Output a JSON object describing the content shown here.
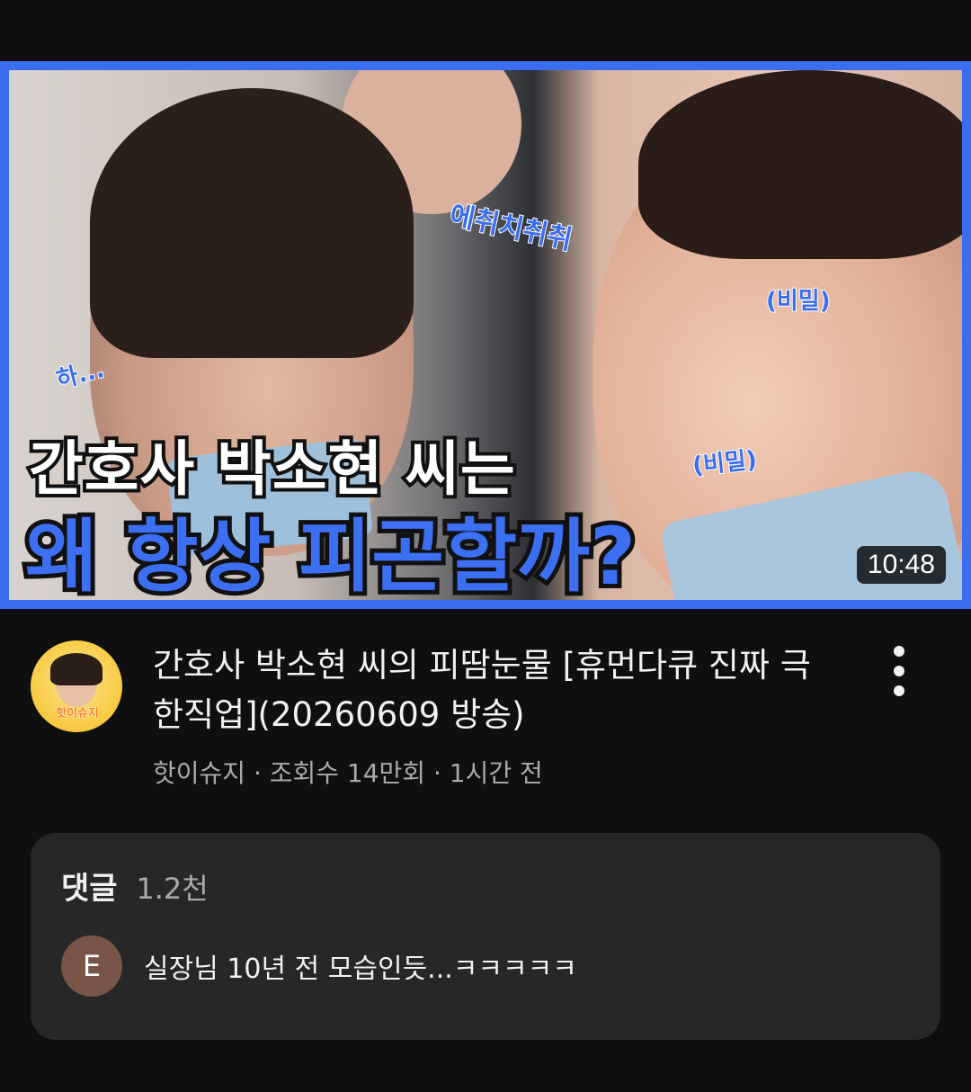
{
  "thumbnail": {
    "duration": "10:48",
    "overlay_line1": "간호사 박소현 씨는",
    "overlay_line2": "왜 항상 피곤할까?",
    "stickers": {
      "sneeze": "에취치취취",
      "sigh": "하...",
      "secret1": "(비밀)",
      "secret2": "(비밀)"
    }
  },
  "channel": {
    "name": "핫이슈지",
    "avatar_label": "핫이슈지"
  },
  "video": {
    "title": "간호사 박소현 씨의 피땀눈물 [휴먼다큐 진짜 극한직업](20260609 방송)",
    "meta": "핫이슈지 · 조회수 14만회 · 1시간 전"
  },
  "comments": {
    "label": "댓글",
    "count": "1.2천",
    "top_comment": {
      "avatar_letter": "E",
      "text": "실장님 10년 전 모습인듯...ㅋㅋㅋㅋㅋ"
    }
  },
  "colors": {
    "background": "#0f0f0f",
    "accent_blue": "#3b6df0",
    "comment_box": "#272727",
    "comment_avatar": "#795548"
  },
  "icons": {
    "more": "more-vertical-icon"
  }
}
